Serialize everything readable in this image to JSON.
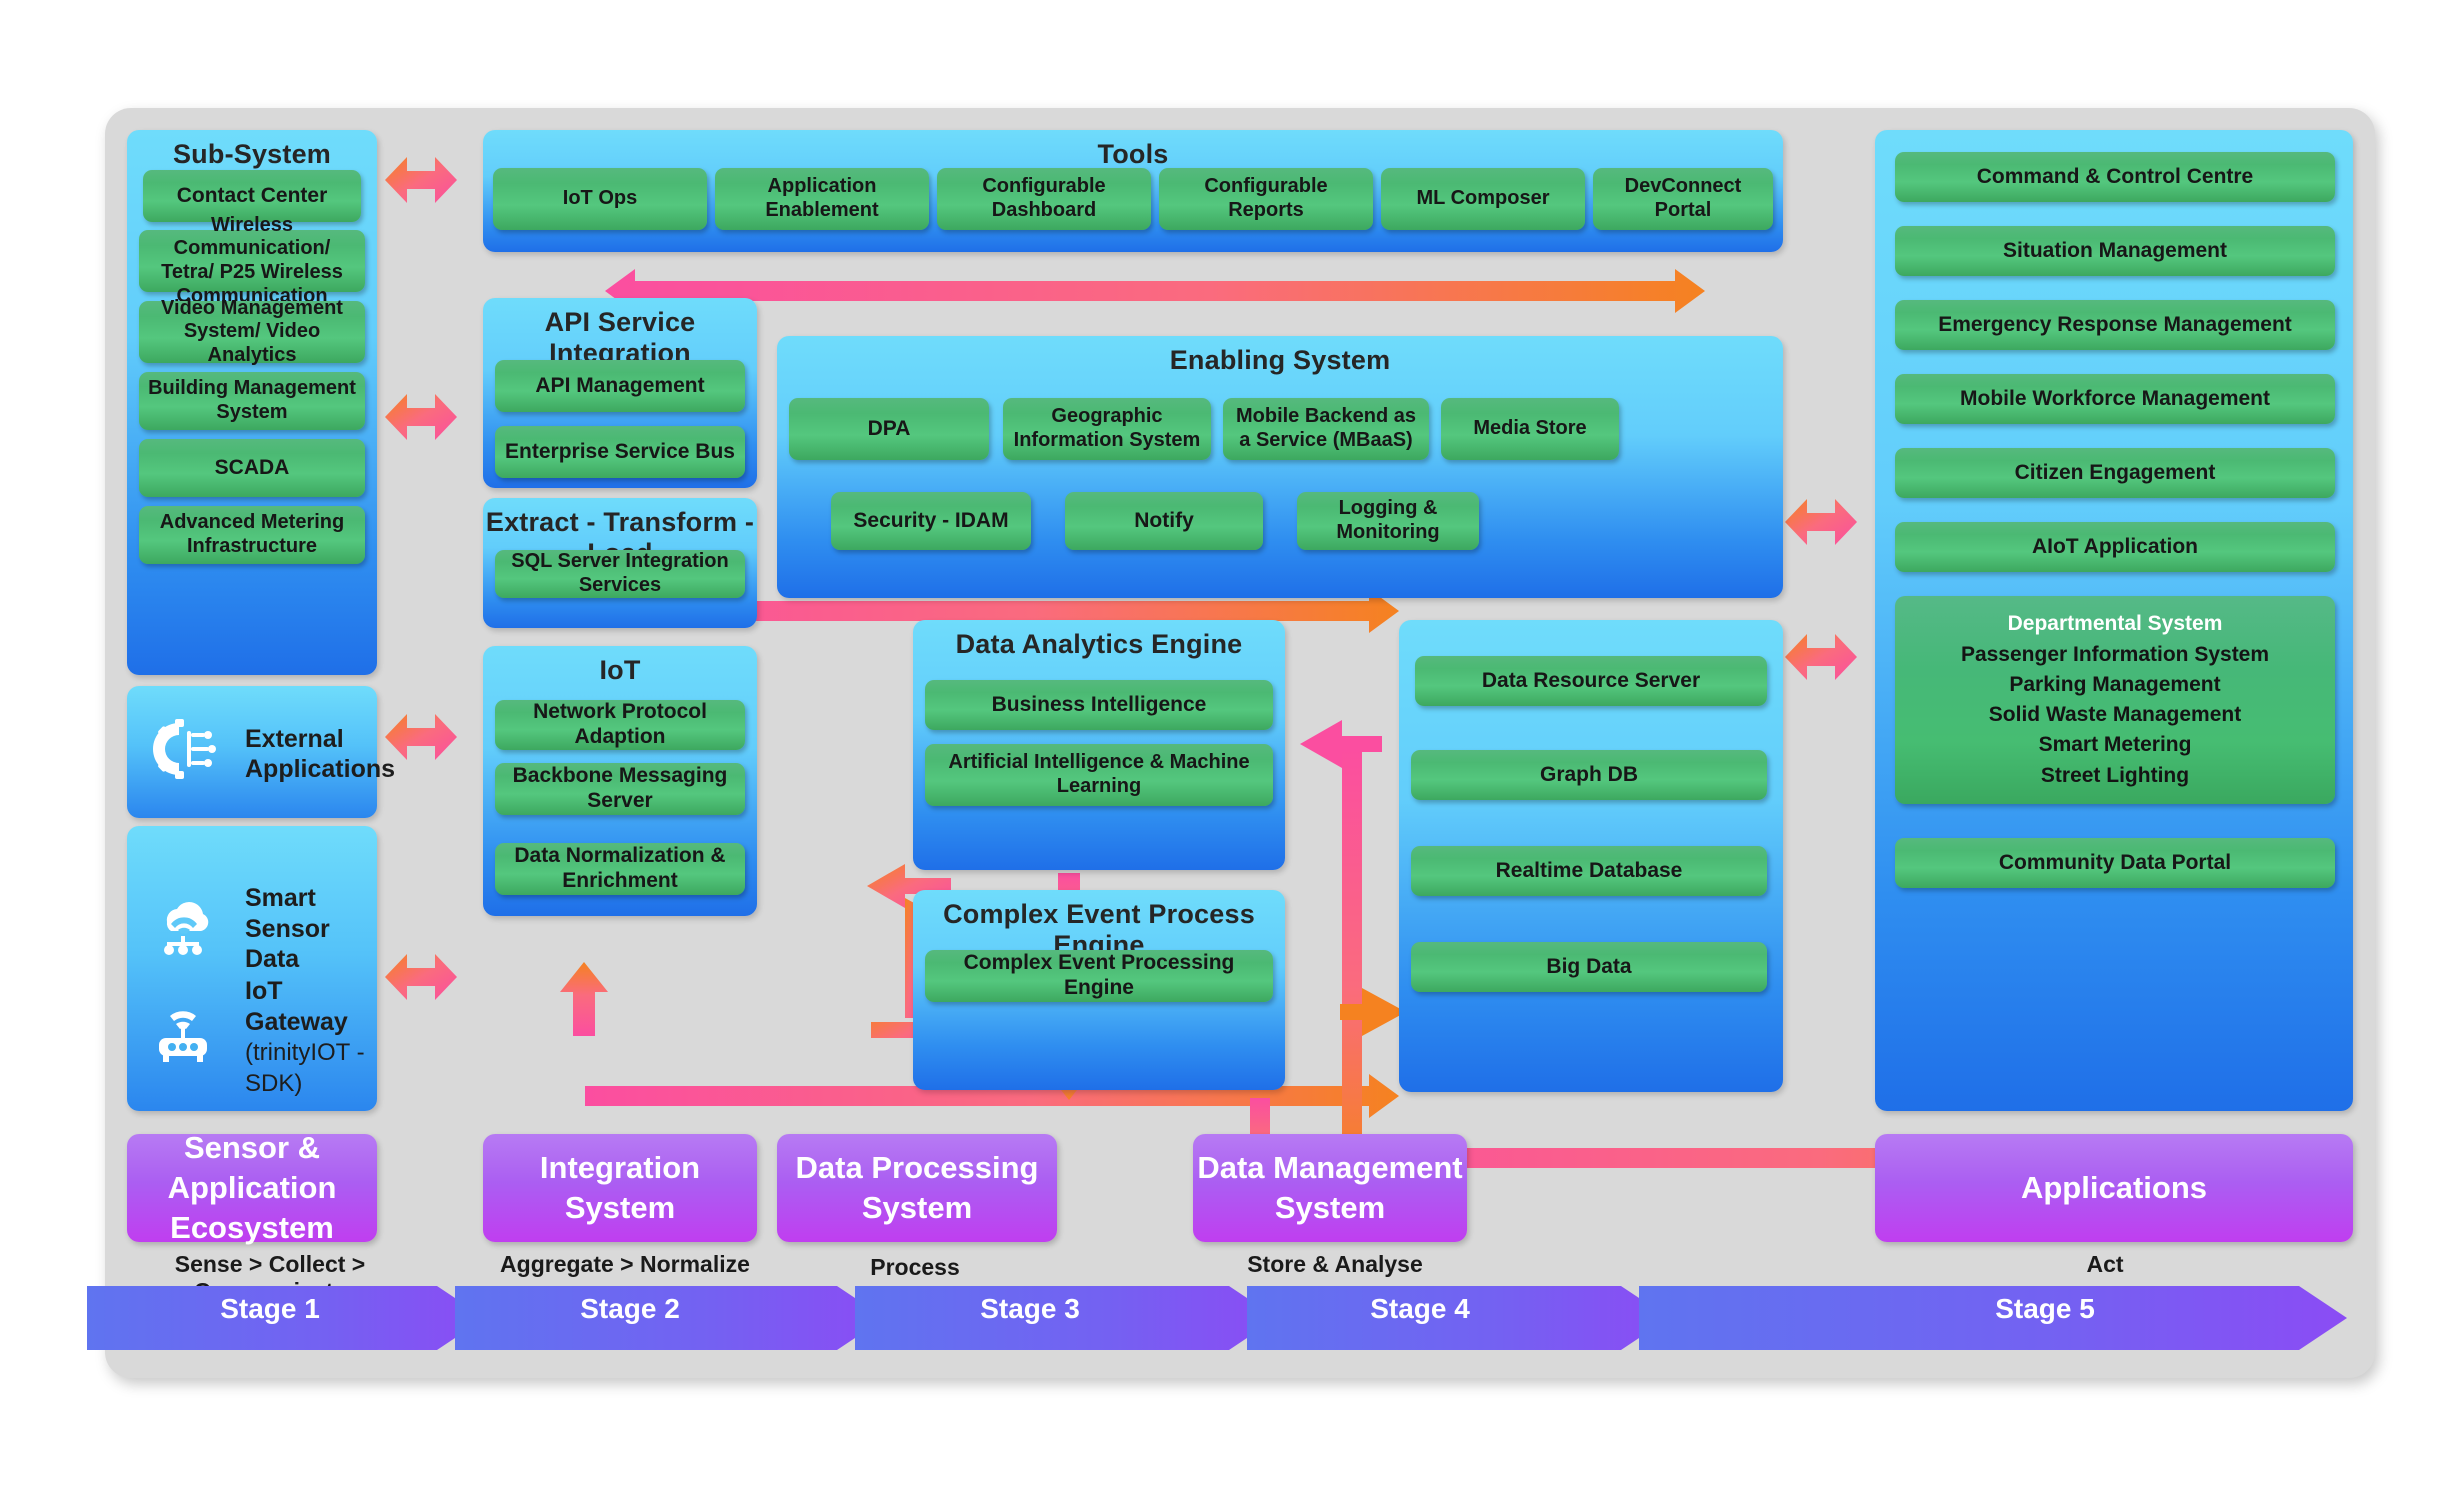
{
  "subsystem": {
    "title": "Sub-System",
    "items": [
      "Contact Center",
      "Wireless Communication/ Tetra/ P25 Wireless Communication",
      "Video Management System/ Video Analytics",
      "Building Management System",
      "SCADA",
      "Advanced Metering Infrastructure"
    ]
  },
  "external": {
    "label": "External Applications",
    "icon": "gear-circuit-icon"
  },
  "sensors": {
    "smart": {
      "label": "Smart Sensor Data",
      "icon": "cloud-wifi-icon"
    },
    "gateway": {
      "label": "IoT Gateway",
      "sub": "(trinityIOT - SDK)",
      "icon": "router-wifi-icon"
    }
  },
  "tools": {
    "title": "Tools",
    "items": [
      "IoT Ops",
      "Application Enablement",
      "Configurable Dashboard",
      "Configurable Reports",
      "ML Composer",
      "DevConnect Portal"
    ]
  },
  "api": {
    "title": "API Service Integration",
    "items": [
      "API Management",
      "Enterprise Service Bus"
    ]
  },
  "etl": {
    "title": "Extract - Transform - Load",
    "items": [
      "SQL Server Integration Services"
    ]
  },
  "iot": {
    "title": "IoT",
    "items": [
      "Network Protocol Adaption",
      "Backbone Messaging Server",
      "Data Normalization & Enrichment"
    ]
  },
  "enabling": {
    "title": "Enabling System",
    "row1": [
      "DPA",
      "Geographic Information System",
      "Mobile Backend as a Service (MBaaS)",
      "Media Store"
    ],
    "row2": [
      "Security - IDAM",
      "Notify",
      "Logging & Monitoring"
    ]
  },
  "analytics": {
    "title": "Data Analytics Engine",
    "items": [
      "Business Intelligence",
      "Artificial Intelligence & Machine Learning"
    ]
  },
  "cep": {
    "title": "Complex Event Process Engine",
    "items": [
      "Complex Event Processing Engine"
    ]
  },
  "datamgmt": {
    "items": [
      "Data Resource Server",
      "Graph DB",
      "Realtime Database",
      "Big Data"
    ]
  },
  "applications": {
    "items": [
      "Command & Control Centre",
      "Situation Management",
      "Emergency Response Management",
      "Mobile Workforce Management",
      "Citizen Engagement",
      "AIoT Application"
    ],
    "departmental": [
      "Departmental System",
      "Passenger Information System",
      "Parking Management",
      "Solid Waste Management",
      "Smart Metering",
      "Street Lighting"
    ],
    "portal": "Community Data Portal"
  },
  "stages": [
    {
      "box": "Sensor & Application Ecosystem",
      "caption": "Sense > Collect > Communicate",
      "label": "Stage 1"
    },
    {
      "box": "Integration System",
      "caption": "Aggregate > Normalize",
      "label": "Stage 2"
    },
    {
      "box": "Data Processing System",
      "caption": "Process",
      "label": "Stage 3"
    },
    {
      "box": "Data Management System",
      "caption": "Store & Analyse",
      "label": "Stage 4"
    },
    {
      "box": "Applications",
      "caption": "Act",
      "label": "Stage 5"
    }
  ],
  "colors": {
    "panel_top": "#6fdcfb",
    "panel_bottom": "#1f6fe8",
    "chip_green": "#4bb973",
    "stage_purple": "#b03cf0",
    "arrow_orange": "#f58220",
    "arrow_pink": "#fb4ea0",
    "background": "#d9d9d9"
  }
}
